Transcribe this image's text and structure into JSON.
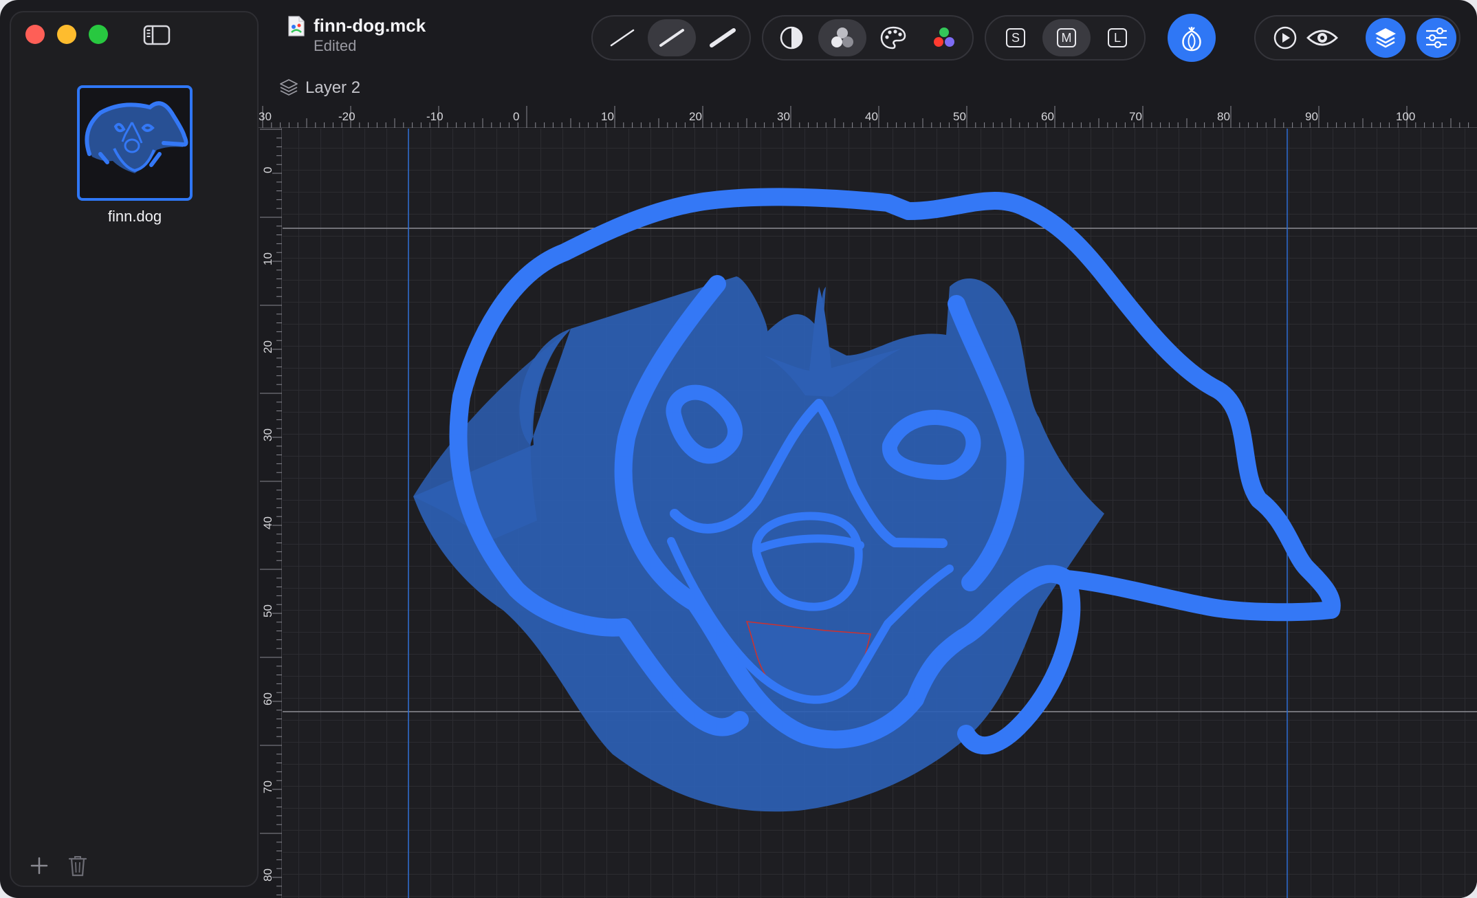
{
  "window": {
    "file_name": "finn-dog.mck",
    "status": "Edited"
  },
  "sidebar": {
    "items": [
      {
        "label": "finn.dog",
        "selected": true
      }
    ]
  },
  "toolbar": {
    "stroke_widths": [
      "thin",
      "medium",
      "thick"
    ],
    "selected_stroke": "medium",
    "color_tools": [
      "contrast-icon",
      "blend-icon",
      "palette-icon",
      "color-dots-icon"
    ],
    "sizes": [
      "S",
      "M",
      "L"
    ],
    "selected_size": "M",
    "right_tools": [
      "play-icon",
      "eye-icon",
      "layers-icon",
      "sliders-icon"
    ]
  },
  "layer": {
    "label": "Layer 2"
  },
  "ruler": {
    "h_labels": [
      "30",
      "-20",
      "-10",
      "0",
      "10",
      "20",
      "30",
      "40",
      "50",
      "60",
      "70",
      "80",
      "90",
      "100"
    ],
    "v_labels": [
      "0",
      "10",
      "20",
      "30",
      "40",
      "50",
      "60",
      "70",
      "80"
    ]
  },
  "colors": {
    "accent": "#2f77f5",
    "stroke": "#3478f6",
    "fill": "#2d5fb4",
    "tongue_outline": "#d0312d"
  }
}
